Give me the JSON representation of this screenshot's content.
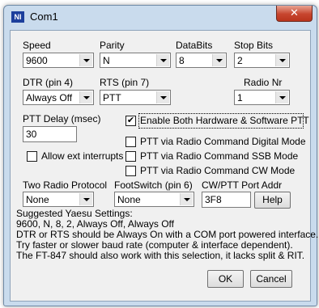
{
  "window": {
    "app_icon_text": "NI",
    "title": "Com1",
    "close_glyph": "✕"
  },
  "speed": {
    "label": "Speed",
    "value": "9600"
  },
  "parity": {
    "label": "Parity",
    "value": "N"
  },
  "databits": {
    "label": "DataBits",
    "value": "8"
  },
  "stopbits": {
    "label": "Stop Bits",
    "value": "2"
  },
  "dtr": {
    "label": "DTR (pin 4)",
    "value": "Always Off"
  },
  "rts": {
    "label": "RTS (pin 7)",
    "value": "PTT"
  },
  "radio_nr": {
    "label": "Radio Nr",
    "value": "1"
  },
  "ptt_delay": {
    "label": "PTT Delay  (msec)",
    "value": "30"
  },
  "checkboxes": {
    "enable_both": {
      "label": "Enable Both Hardware & Software PTT",
      "checked": true,
      "mark": "✔"
    },
    "allow_ext": {
      "label": "Allow ext interrupts",
      "checked": false
    },
    "ptt_digital": {
      "label": "PTT via Radio Command Digital Mode",
      "checked": false
    },
    "ptt_ssb": {
      "label": "PTT via Radio Command SSB Mode",
      "checked": false
    },
    "ptt_cw": {
      "label": "PTT via Radio Command CW Mode",
      "checked": false
    }
  },
  "two_radio": {
    "label": "Two Radio Protocol",
    "value": "None"
  },
  "footswitch": {
    "label": "FootSwitch (pin 6)",
    "value": "None"
  },
  "cw_ptt": {
    "label": "CW/PTT Port Addr",
    "value": "3F8"
  },
  "buttons": {
    "help": "Help",
    "ok": "OK",
    "cancel": "Cancel"
  },
  "info_lines": [
    "Suggested Yaesu Settings:",
    "9600, N, 8, 2, Always Off, Always Off",
    "DTR or RTS should be Always On with a COM port powered interface.",
    "Try faster or slower baud rate (computer & interface dependent).",
    "The FT-847 should also work with this selection, it lacks split & RIT."
  ]
}
